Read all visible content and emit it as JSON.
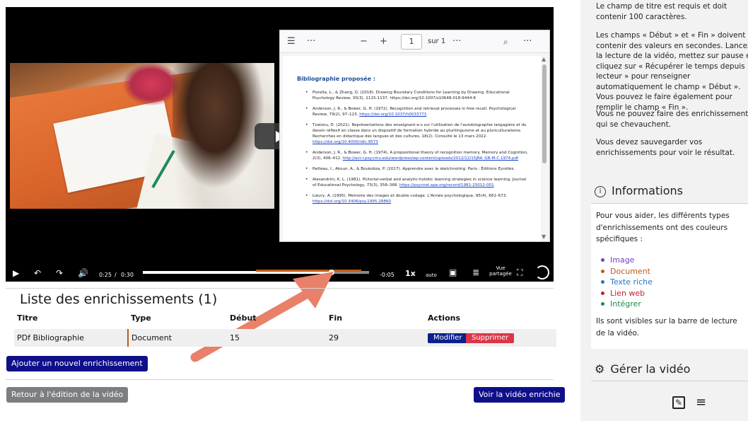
{
  "pdf": {
    "page_number": "1",
    "page_total": "sur 1",
    "heading": "Bibliographie proposée :",
    "refs": [
      {
        "text": "Fiorella, L., & Zhang, Q. (2018). Drawing Boundary Conditions for Learning by Drawing. Educational Psychology Review, 30(3), 1115-1137. https://doi.org/10.1007/s10648-018-9444-8",
        "link": ""
      },
      {
        "text": "Anderson, J. R., & Bower, G. H. (1972). Recognition and retrieval processes in free recall. Psychological Review, 79(2), 97–123.",
        "link": "https://doi.org/10.1037/h0033773"
      },
      {
        "text": "Tzatzou, D. (2021). Représentations des enseignant-e-s sur l'utilisation de l'autobiographie langagière et du dessin réflexif en classe dans un dispositif de formation hybride au plurilinguisme et au pluriculturalisme. Recherches en didactique des langues et des cultures, 18(2). Consulté le 13 mars 2022.",
        "link": "https://doi.org/10.4000/rdlc.9573"
      },
      {
        "text": "Anderson, J. R., & Bower, G. H. (1974). A propositional theory of recognition memory. Memory and Cognition, 2(3), 406–412.",
        "link": "http://act-r.psy.cmu.edu/wordpress/wp-content/uploads/2012/12/15JRA_GB-M-C.1974.pdf"
      },
      {
        "text": "Pailleau, I., Akoun, A., & Boukobza, P. (2017). Apprendre avec le sketchnoting. Paris : Éditions Eyrolles.",
        "link": ""
      },
      {
        "text": "Alesandrini, K. L. (1981). Pictorial-verbal and analytic-holistic learning strategies in science learning. Journal of Educational Psychology, 73(3), 358–368.",
        "link": "https://psycnet.apa.org/record/1981-25012-001"
      },
      {
        "text": "Lieury, A. (1995). Mémoire des images et double codage. L'Année psychologique, 95(4), 661–673.",
        "link": "https://doi.org/10.3406/psy.1995.28860"
      }
    ]
  },
  "player": {
    "current_time": "0:25",
    "separator": "/",
    "duration": "0:30",
    "remaining": "-0:05",
    "speed": "1x",
    "quality": "auto",
    "shared_view": "Vue partagée",
    "progress_fraction": 0.833,
    "chapter_start_fraction": 0.5,
    "chapter_end_fraction": 0.967
  },
  "enrichments": {
    "title": "Liste des enrichissements (1)",
    "columns": [
      "Titre",
      "Type",
      "Début",
      "Fin",
      "Actions"
    ],
    "rows": [
      {
        "titre": "PDf Bibliographie",
        "type": "Document",
        "debut": "15",
        "fin": "29"
      }
    ],
    "edit_label": "Modifier",
    "delete_label": "Supprimer",
    "add_label": "Ajouter un nouvel enrichissement",
    "back_label": "Retour à l'édition de la vidéo",
    "view_label": "Voir la vidéo enrichie"
  },
  "sidebar": {
    "help_p1": "Le champ de titre est requis et doit contenir 100 caractères.",
    "help_p2": "Les champs « Début » et « Fin » doivent contenir des valeurs en secondes. Lancez la lecture de la vidéo, mettez sur pause et cliquez sur « Récupérer le temps depuis le lecteur » pour renseigner automatiquement le champ « Début ». Vous pouvez le faire également pour remplir le champ « Fin ».",
    "help_p3": "Vous ne pouvez faire des enrichissements qui se chevauchent.",
    "help_p4": "Vous devez sauvegarder vos enrichissements pour voir le résultat.",
    "info_title": "Informations",
    "info_text": "Pour vous aider, les différents types d'enrichissements ont des couleurs spécifiques :",
    "legend": [
      {
        "label": "Image",
        "color": "#6f42c1"
      },
      {
        "label": "Document",
        "color": "#c05a18"
      },
      {
        "label": "Texte riche",
        "color": "#1f77c4"
      },
      {
        "label": "Lien web",
        "color": "#c4222e"
      },
      {
        "label": "Intégrer",
        "color": "#1e8a4f"
      }
    ],
    "visible_text": "Ils sont visibles sur la barre de lecture de la vidéo.",
    "manage_title": "Gérer la vidéo"
  },
  "colors": {
    "document_marker": "#c05a18",
    "primary_button": "#100f8a",
    "danger_button": "#dc3545",
    "secondary_button": "#7b7f82",
    "annotation_arrow": "#e8806a"
  },
  "icons": [
    "sidebar-toggle-icon",
    "more-icon",
    "zoom-out-icon",
    "zoom-in-icon",
    "search-icon",
    "play-icon",
    "replay-icon",
    "forward-icon",
    "volume-icon",
    "pip-icon",
    "chapters-icon",
    "fullscreen-icon",
    "logo-icon",
    "info-icon",
    "gear-icon",
    "edit-icon",
    "menu-icon"
  ]
}
